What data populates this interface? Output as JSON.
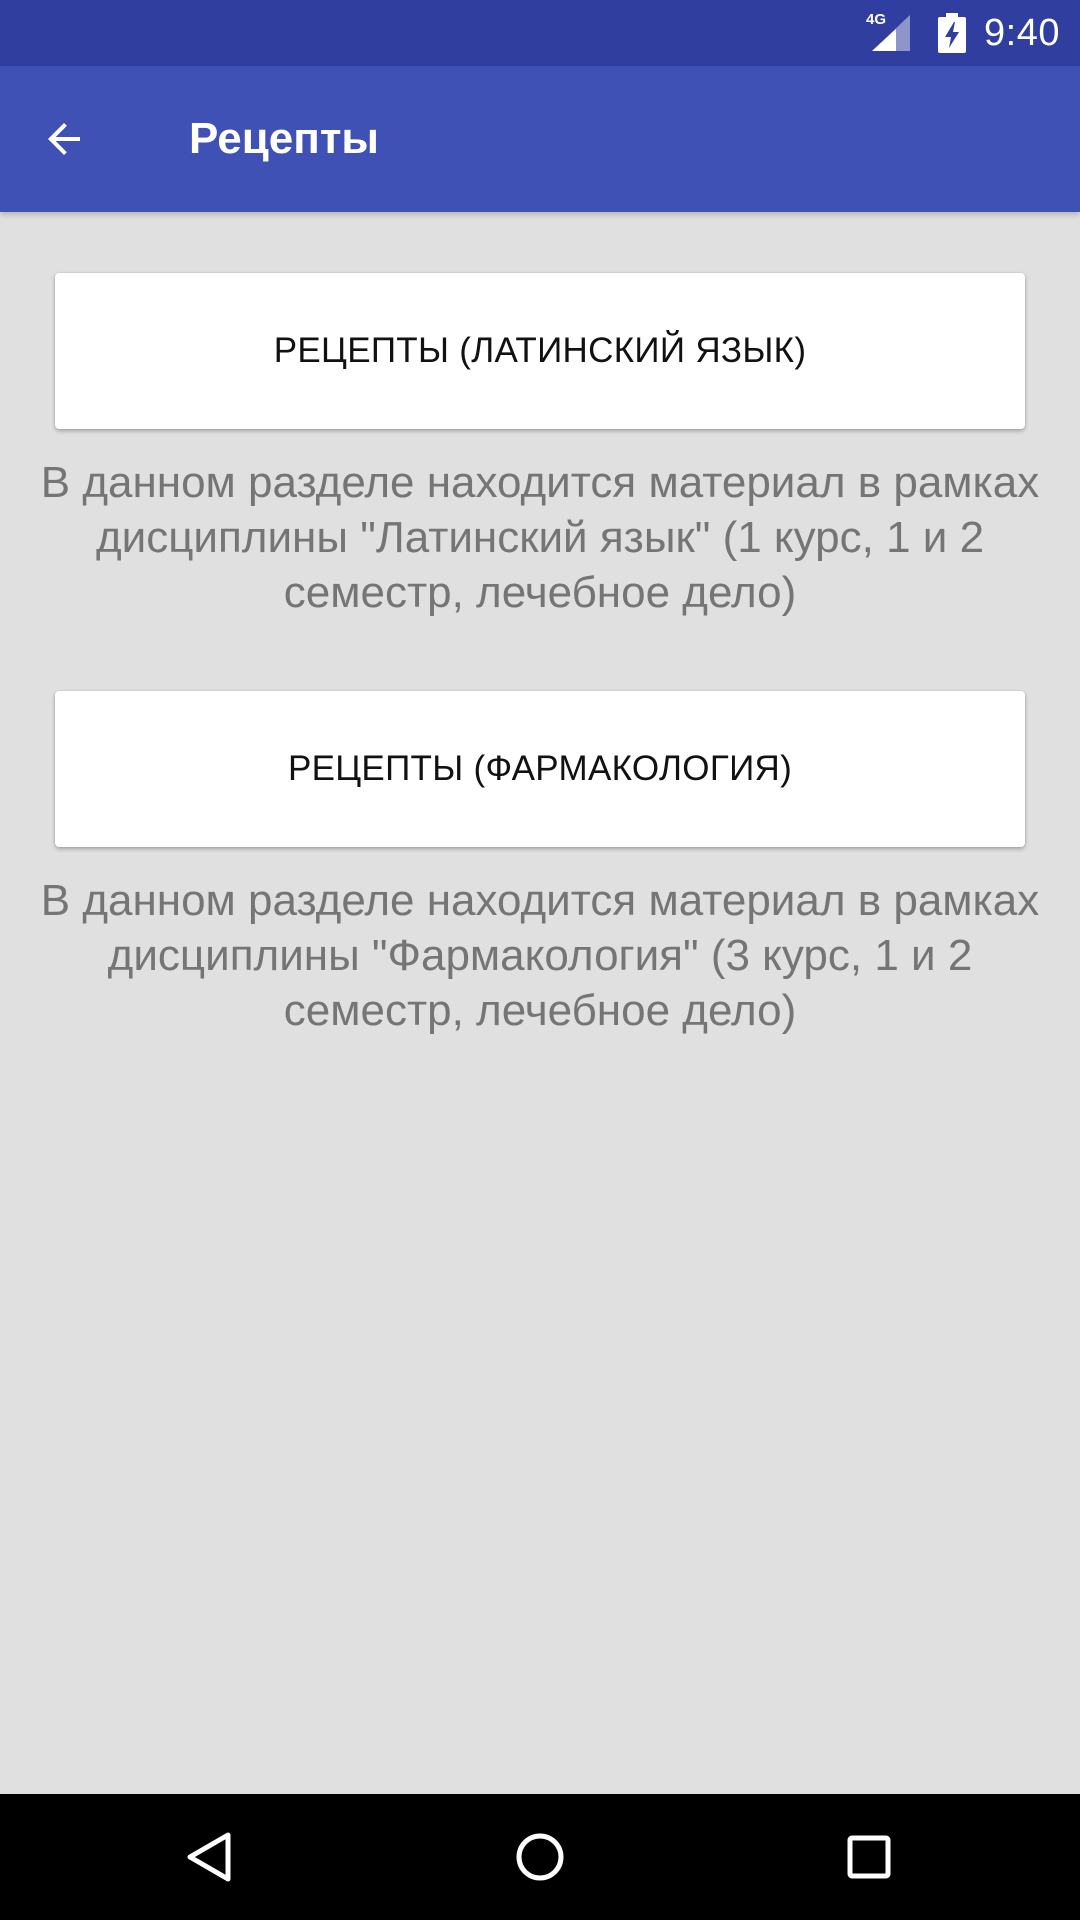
{
  "status_bar": {
    "network_label": "4G",
    "time": "9:40",
    "icons": [
      "signal-icon",
      "battery-charging-icon"
    ]
  },
  "app_bar": {
    "title": "Рецепты",
    "back_icon": "arrow-back-icon",
    "color": "#3f51b5",
    "status_color": "#303f9f"
  },
  "sections": [
    {
      "button_label": "РЕЦЕПТЫ (ЛАТИНСКИЙ ЯЗЫК)",
      "description": "В данном разделе находится материал в рамках дисциплины \"Латинский язык\" (1 курс, 1 и 2 семестр, лечебное дело)"
    },
    {
      "button_label": "РЕЦЕПТЫ (ФАРМАКОЛОГИЯ)",
      "description": "В данном разделе находится материал в рамках дисциплины \"Фармакология\" (3 курс, 1 и 2 семестр, лечебное дело)"
    }
  ],
  "nav_bar": {
    "icons": [
      "nav-back-icon",
      "nav-home-icon",
      "nav-recents-icon"
    ]
  }
}
